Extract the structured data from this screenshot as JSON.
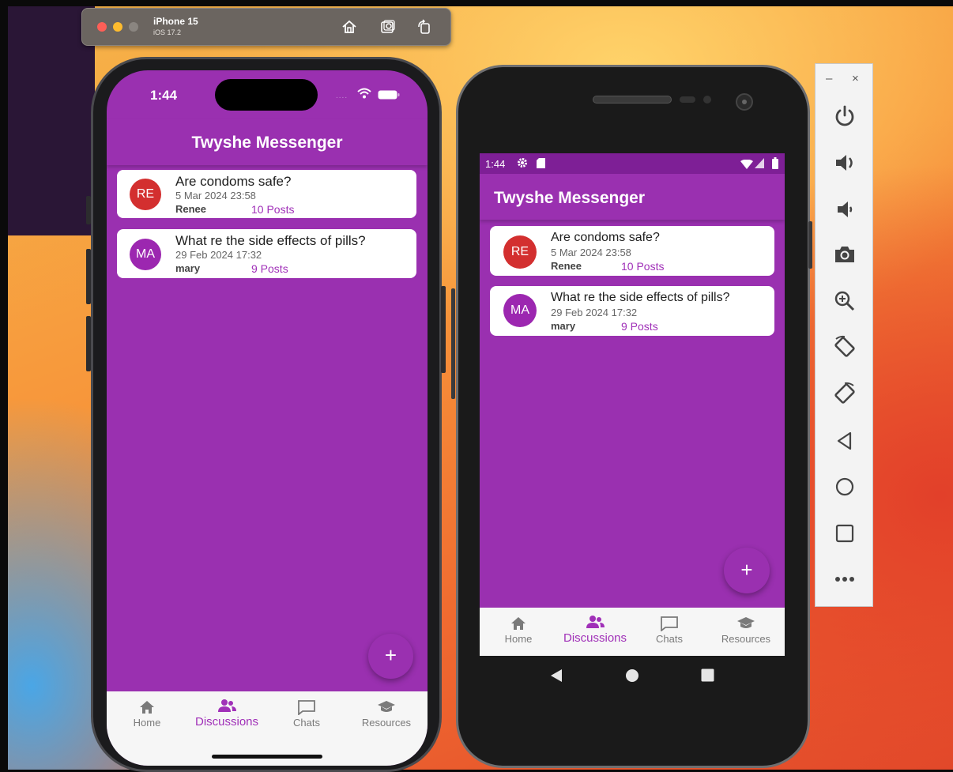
{
  "simulator": {
    "device_name": "iPhone 15",
    "os_version": "iOS 17.2",
    "icons": [
      "home-icon",
      "screenshot-icon",
      "rotate-icon"
    ]
  },
  "ios": {
    "status_time": "1:44",
    "app_title": "Twyshe Messenger",
    "discussions": [
      {
        "initials": "RE",
        "avatar_color": "#d32f2f",
        "title": "Are condoms safe?",
        "date": "5 Mar 2024 23:58",
        "author": "Renee",
        "posts": "10 Posts"
      },
      {
        "initials": "MA",
        "avatar_color": "#9c27b0",
        "title": "What re the side effects of pills?",
        "date": "29 Feb 2024 17:32",
        "author": "mary",
        "posts": "9 Posts"
      }
    ],
    "fab_label": "+",
    "nav": [
      {
        "label": "Home",
        "icon": "home-icon",
        "active": false
      },
      {
        "label": "Discussions",
        "icon": "people-icon",
        "active": true
      },
      {
        "label": "Chats",
        "icon": "chat-bubble-icon",
        "active": false
      },
      {
        "label": "Resources",
        "icon": "graduation-cap-icon",
        "active": false
      }
    ]
  },
  "android": {
    "status_time": "1:44",
    "app_title": "Twyshe Messenger",
    "discussions": [
      {
        "initials": "RE",
        "avatar_color": "#d32f2f",
        "title": "Are condoms safe?",
        "date": "5 Mar 2024 23:58",
        "author": "Renee",
        "posts": "10 Posts"
      },
      {
        "initials": "MA",
        "avatar_color": "#9c27b0",
        "title": "What re the side effects of pills?",
        "date": "29 Feb 2024 17:32",
        "author": "mary",
        "posts": "9 Posts"
      }
    ],
    "fab_label": "+",
    "nav": [
      {
        "label": "Home",
        "icon": "home-icon",
        "active": false
      },
      {
        "label": "Discussions",
        "icon": "people-icon",
        "active": true
      },
      {
        "label": "Chats",
        "icon": "chat-bubble-icon",
        "active": false
      },
      {
        "label": "Resources",
        "icon": "graduation-cap-icon",
        "active": false
      }
    ]
  },
  "emulator_panel": {
    "minimize_label": "–",
    "close_label": "×",
    "buttons": [
      "power-icon",
      "volume-up-icon",
      "volume-down-icon",
      "camera-icon",
      "zoom-in-icon",
      "rotate-left-icon",
      "rotate-right-icon",
      "back-icon",
      "home-circle-icon",
      "overview-icon",
      "more-icon"
    ]
  },
  "colors": {
    "app_purple": "#9a30b0",
    "status_purple": "#7e1f96",
    "active_nav": "#a030b8"
  }
}
